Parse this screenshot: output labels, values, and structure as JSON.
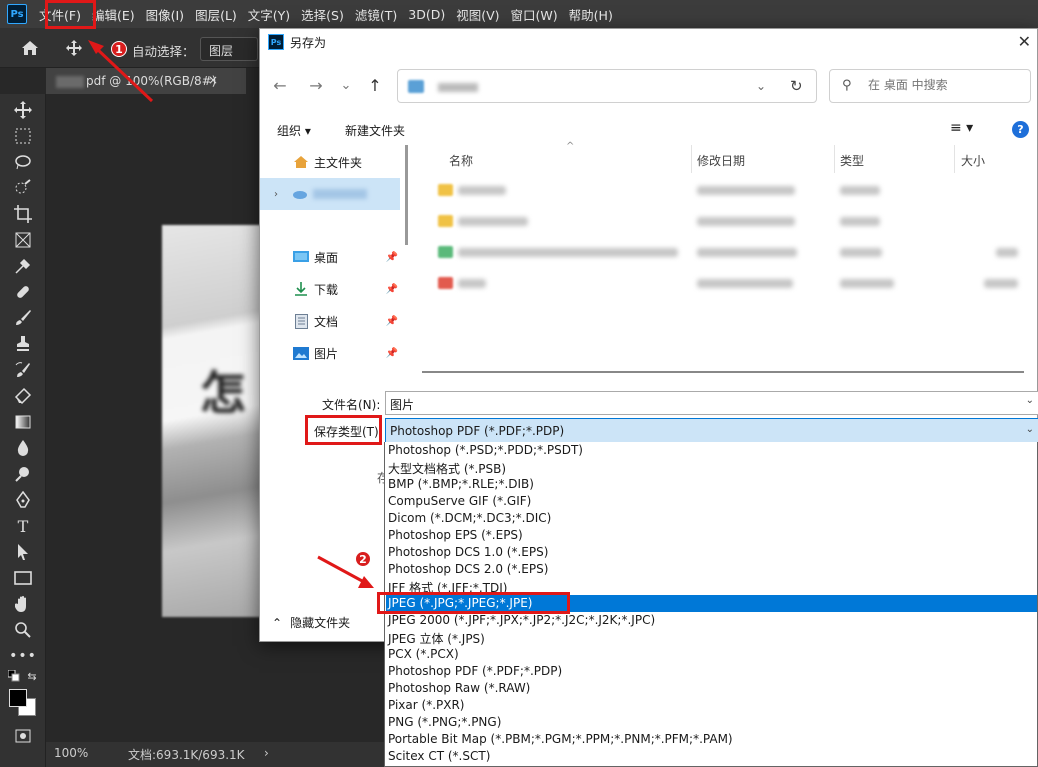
{
  "app": {
    "logo": "Ps",
    "menu": [
      "文件(F)",
      "编辑(E)",
      "图像(I)",
      "图层(L)",
      "文字(Y)",
      "选择(S)",
      "滤镜(T)",
      "3D(D)",
      "视图(V)",
      "窗口(W)",
      "帮助(H)"
    ]
  },
  "options_bar": {
    "auto_select_label": "自动选择：",
    "layer_select_value": "图层"
  },
  "doc_tab": {
    "title": "pdf @ 100%(RGB/8#)",
    "close": "×"
  },
  "status_bar": {
    "zoom": "100%",
    "doc_size": "文档:693.1K/693.1K",
    "arrow": "›"
  },
  "dialog": {
    "title": "另存为",
    "close": "✕",
    "nav": {
      "back": "←",
      "forward": "→",
      "recent": "⌄",
      "up": "↑"
    },
    "address": {
      "segment": "› 桌面 ›",
      "chevron": "⌄",
      "refresh": "↻"
    },
    "search": {
      "placeholder": "在 桌面 中搜索",
      "icon": "search-icon"
    },
    "commands": {
      "organize": "组织 ▾",
      "new_folder": "新建文件夹",
      "view": "≡ ▾",
      "help": "?"
    },
    "nav_pane": [
      {
        "label": "主文件夹",
        "icon": "home-icon",
        "pinned": false
      },
      {
        "label": "",
        "icon": "onedrive-icon",
        "pinned": false
      },
      {
        "label": "桌面",
        "icon": "desktop-icon",
        "pinned": true
      },
      {
        "label": "下载",
        "icon": "download-icon",
        "pinned": true
      },
      {
        "label": "文档",
        "icon": "documents-icon",
        "pinned": true
      },
      {
        "label": "图片",
        "icon": "pictures-icon",
        "pinned": true
      }
    ],
    "columns": [
      "名称",
      "修改日期",
      "类型",
      "大小"
    ],
    "file_name_label": "文件名(N):",
    "file_name_value": "图片",
    "save_type_label": "保存类型(T):",
    "save_type_value": "Photoshop PDF (*.PDF;*.PDP)",
    "hide_folders": "隐藏文件夹",
    "partial_label": "存"
  },
  "save_types": [
    "Photoshop (*.PSD;*.PDD;*.PSDT)",
    "大型文档格式 (*.PSB)",
    "BMP (*.BMP;*.RLE;*.DIB)",
    "CompuServe GIF (*.GIF)",
    "Dicom (*.DCM;*.DC3;*.DIC)",
    "Photoshop EPS (*.EPS)",
    "Photoshop DCS 1.0 (*.EPS)",
    "Photoshop DCS 2.0 (*.EPS)",
    "IFF 格式 (*.IFF;*.TDI)",
    "JPEG (*.JPG;*.JPEG;*.JPE)",
    "JPEG 2000 (*.JPF;*.JPX;*.JP2;*.J2C;*.J2K;*.JPC)",
    "JPEG 立体 (*.JPS)",
    "PCX (*.PCX)",
    "Photoshop PDF (*.PDF;*.PDP)",
    "Photoshop Raw (*.RAW)",
    "Pixar (*.PXR)",
    "PNG (*.PNG;*.PNG)",
    "Portable Bit Map (*.PBM;*.PGM;*.PPM;*.PNM;*.PFM;*.PAM)",
    "Scitex CT (*.SCT)"
  ],
  "highlighted_type_index": 9,
  "annotations": {
    "badge1": "1",
    "badge2": "2",
    "color": "#e01818"
  }
}
